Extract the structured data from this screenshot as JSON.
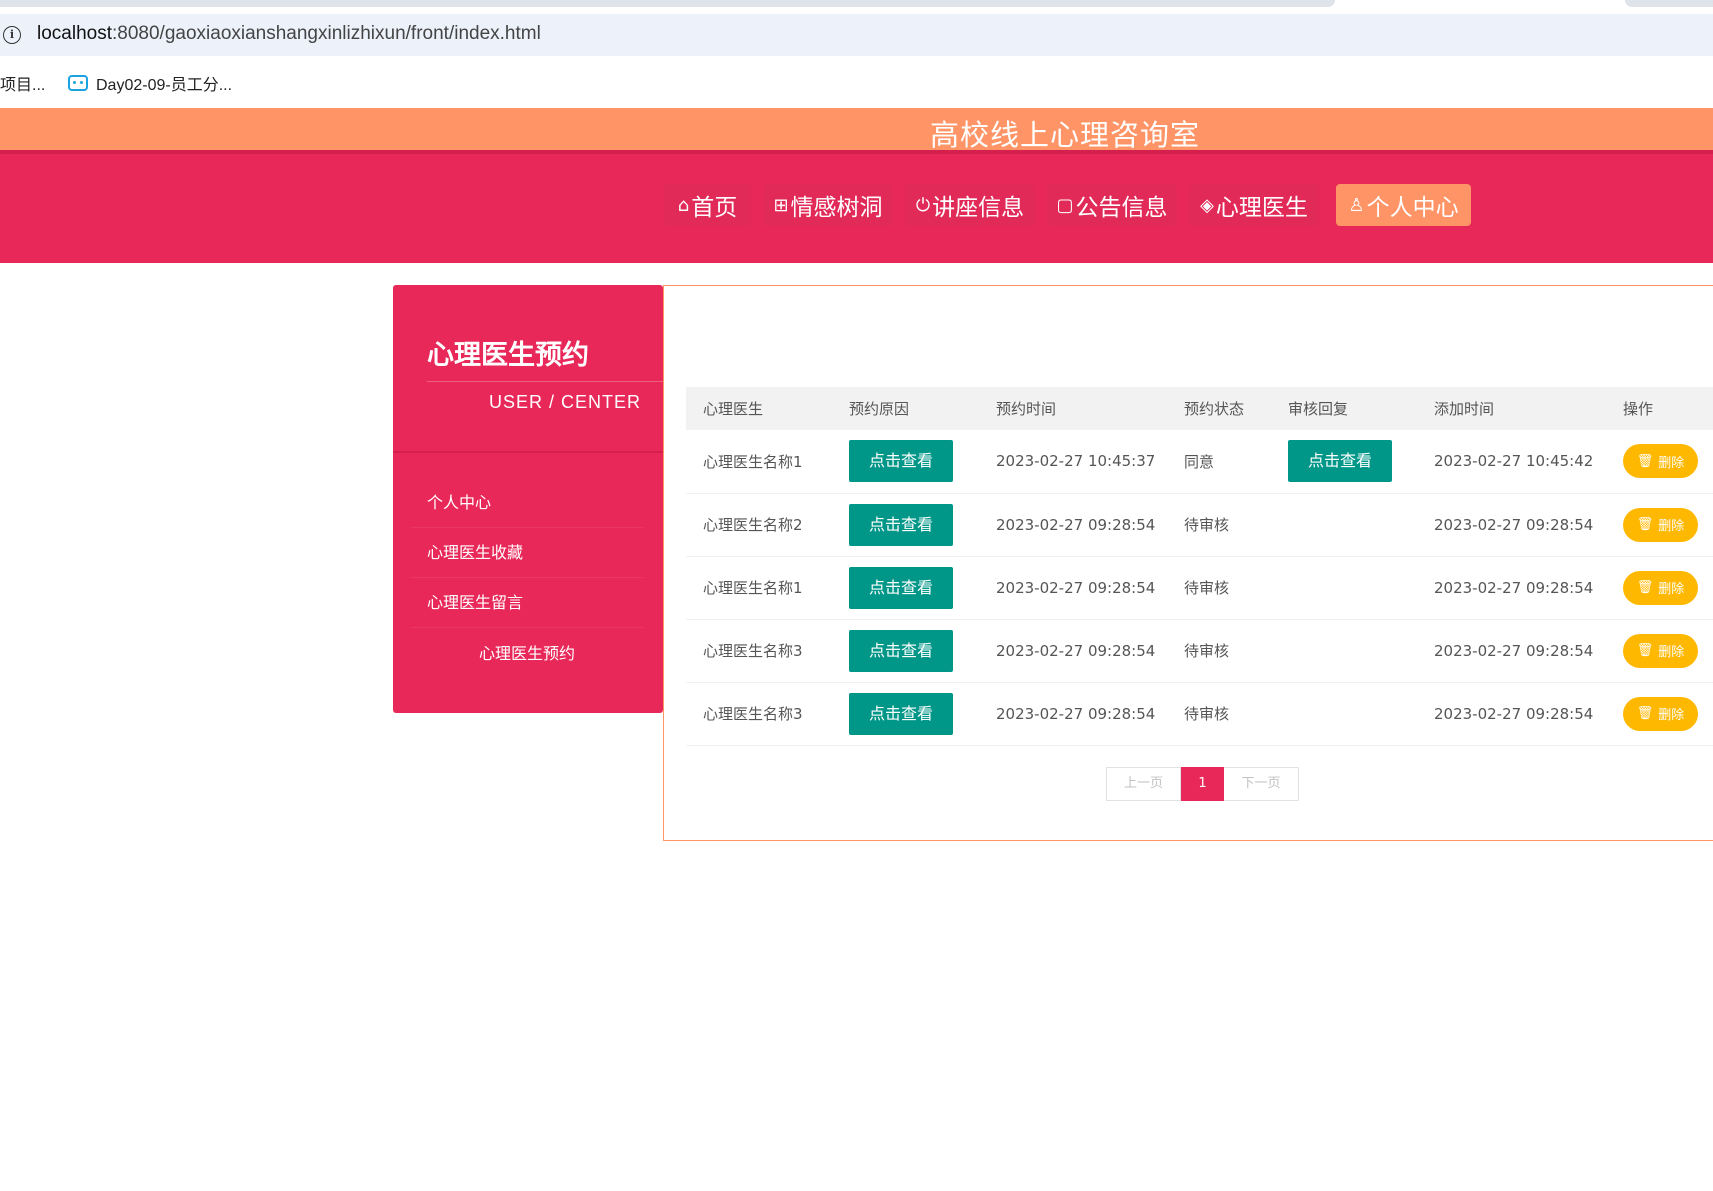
{
  "browser": {
    "url_host": "localhost",
    "url_rest": ":8080/gaoxiaoxianshangxinlizhixun/front/index.html",
    "bookmarks": [
      "项目...",
      "Day02-09-员工分..."
    ]
  },
  "site": {
    "title": "高校线上心理咨询室"
  },
  "nav": {
    "items": [
      {
        "icon": "⌂",
        "label": "首页"
      },
      {
        "icon": "⊞",
        "label": "情感树洞"
      },
      {
        "icon": "⏻",
        "label": "讲座信息"
      },
      {
        "icon": "▢",
        "label": "公告信息"
      },
      {
        "icon": "◈",
        "label": "心理医生"
      },
      {
        "icon": "♙",
        "label": "个人中心"
      }
    ]
  },
  "sidebar": {
    "title": "心理医生预约",
    "subtitle": "USER / CENTER",
    "items": [
      "个人中心",
      "心理医生收藏",
      "心理医生留言",
      "心理医生预约"
    ]
  },
  "table": {
    "headers": [
      "心理医生",
      "预约原因",
      "预约时间",
      "预约状态",
      "审核回复",
      "添加时间",
      "操作"
    ],
    "view_label": "点击查看",
    "delete_label": "删除",
    "rows": [
      {
        "doctor": "心理医生名称1",
        "time": "2023-02-27 10:45:37",
        "status": "同意",
        "has_reply": true,
        "added": "2023-02-27 10:45:42"
      },
      {
        "doctor": "心理医生名称2",
        "time": "2023-02-27 09:28:54",
        "status": "待审核",
        "has_reply": false,
        "added": "2023-02-27 09:28:54"
      },
      {
        "doctor": "心理医生名称1",
        "time": "2023-02-27 09:28:54",
        "status": "待审核",
        "has_reply": false,
        "added": "2023-02-27 09:28:54"
      },
      {
        "doctor": "心理医生名称3",
        "time": "2023-02-27 09:28:54",
        "status": "待审核",
        "has_reply": false,
        "added": "2023-02-27 09:28:54"
      },
      {
        "doctor": "心理医生名称3",
        "time": "2023-02-27 09:28:54",
        "status": "待审核",
        "has_reply": false,
        "added": "2023-02-27 09:28:54"
      }
    ]
  },
  "pager": {
    "prev": "上一页",
    "current": "1",
    "next": "下一页"
  },
  "colors": {
    "primary": "#e9285a",
    "accent": "#ff9466",
    "teal": "#009688",
    "delete": "#ffb800"
  }
}
